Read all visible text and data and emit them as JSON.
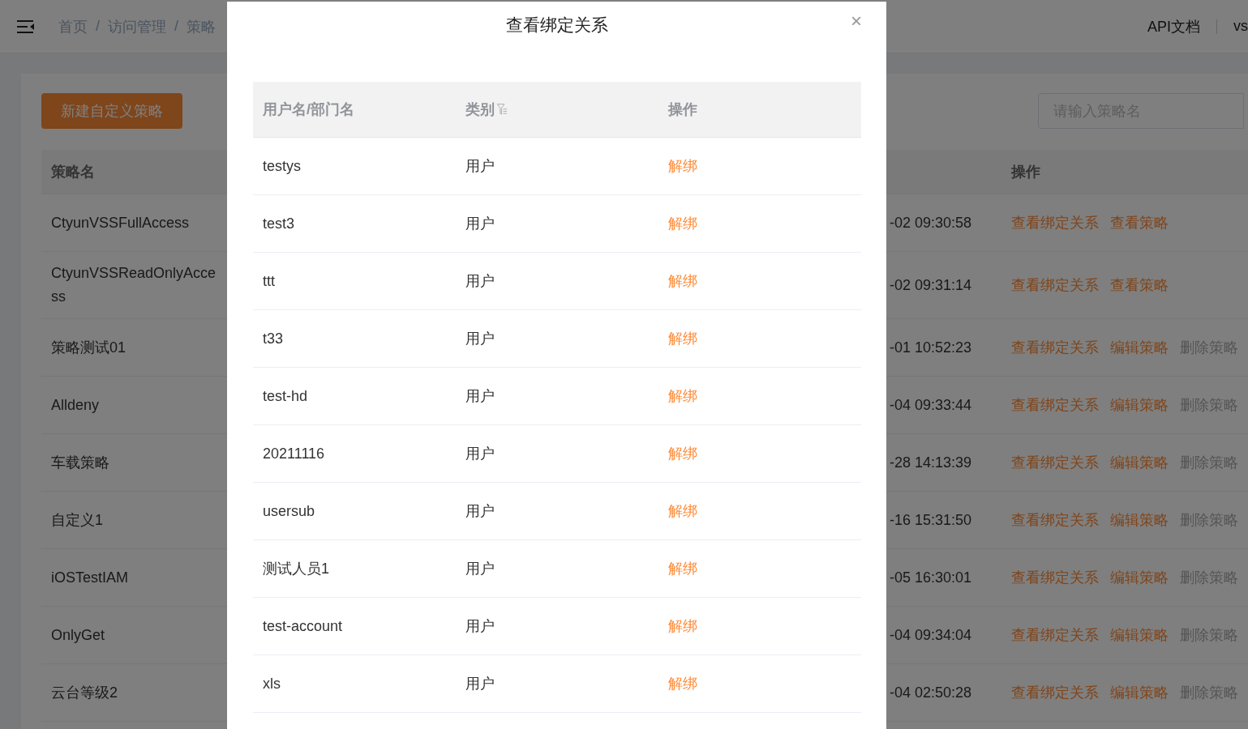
{
  "header": {
    "breadcrumb": [
      "首页",
      "访问管理",
      "策略"
    ],
    "breadcrumb_separator": "/",
    "api_docs": "API文档",
    "user": "vs"
  },
  "toolbar": {
    "create_button": "新建自定义策略",
    "search": {
      "placeholder": "请输入策略名"
    }
  },
  "policy_table": {
    "columns": [
      "策略名",
      "操作"
    ],
    "rows": [
      {
        "name": "CtyunVSSFullAccess",
        "time": "-02 09:30:58",
        "actions": [
          {
            "label": "查看绑定关系",
            "disabled": false
          },
          {
            "label": "查看策略",
            "disabled": false
          }
        ]
      },
      {
        "name": "CtyunVSSReadOnlyAccess",
        "time": "-02 09:31:14",
        "actions": [
          {
            "label": "查看绑定关系",
            "disabled": false
          },
          {
            "label": "查看策略",
            "disabled": false
          }
        ]
      },
      {
        "name": "策略测试01",
        "time": "-01 10:52:23",
        "actions": [
          {
            "label": "查看绑定关系",
            "disabled": false
          },
          {
            "label": "编辑策略",
            "disabled": false
          },
          {
            "label": "删除策略",
            "disabled": true
          }
        ]
      },
      {
        "name": "Alldeny",
        "time": "-04 09:33:44",
        "actions": [
          {
            "label": "查看绑定关系",
            "disabled": false
          },
          {
            "label": "编辑策略",
            "disabled": false
          },
          {
            "label": "删除策略",
            "disabled": true
          }
        ]
      },
      {
        "name": "车载策略",
        "time": "-28 14:13:39",
        "actions": [
          {
            "label": "查看绑定关系",
            "disabled": false
          },
          {
            "label": "编辑策略",
            "disabled": false
          },
          {
            "label": "删除策略",
            "disabled": true
          }
        ]
      },
      {
        "name": "自定义1",
        "time": "-16 15:31:50",
        "actions": [
          {
            "label": "查看绑定关系",
            "disabled": false
          },
          {
            "label": "编辑策略",
            "disabled": false
          },
          {
            "label": "删除策略",
            "disabled": true
          }
        ]
      },
      {
        "name": "iOSTestIAM",
        "time": "-05 16:30:01",
        "actions": [
          {
            "label": "查看绑定关系",
            "disabled": false
          },
          {
            "label": "编辑策略",
            "disabled": false
          },
          {
            "label": "删除策略",
            "disabled": true
          }
        ]
      },
      {
        "name": "OnlyGet",
        "time": "-04 09:34:04",
        "actions": [
          {
            "label": "查看绑定关系",
            "disabled": false
          },
          {
            "label": "编辑策略",
            "disabled": false
          },
          {
            "label": "删除策略",
            "disabled": true
          }
        ]
      },
      {
        "name": "云台等级2",
        "time": "-04 02:50:28",
        "actions": [
          {
            "label": "查看绑定关系",
            "disabled": false
          },
          {
            "label": "编辑策略",
            "disabled": false
          },
          {
            "label": "删除策略",
            "disabled": true
          }
        ]
      }
    ]
  },
  "dialog": {
    "title": "查看绑定关系",
    "close": "×",
    "columns": [
      "用户名/部门名",
      "类别",
      "操作"
    ],
    "rows": [
      {
        "name": "testys",
        "type": "用户",
        "action": "解绑"
      },
      {
        "name": "test3",
        "type": "用户",
        "action": "解绑"
      },
      {
        "name": "ttt",
        "type": "用户",
        "action": "解绑"
      },
      {
        "name": "t33",
        "type": "用户",
        "action": "解绑"
      },
      {
        "name": "test-hd",
        "type": "用户",
        "action": "解绑"
      },
      {
        "name": "20211116",
        "type": "用户",
        "action": "解绑"
      },
      {
        "name": "usersub",
        "type": "用户",
        "action": "解绑"
      },
      {
        "name": "测试人员1",
        "type": "用户",
        "action": "解绑"
      },
      {
        "name": "test-account",
        "type": "用户",
        "action": "解绑"
      },
      {
        "name": "xls",
        "type": "用户",
        "action": "解绑"
      }
    ]
  }
}
